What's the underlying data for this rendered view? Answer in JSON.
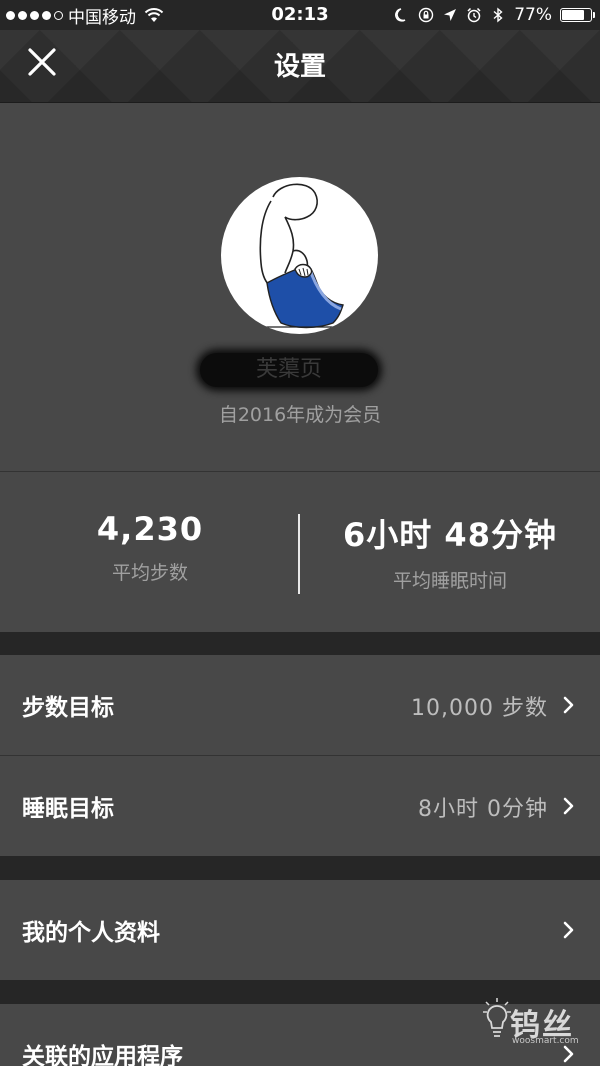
{
  "status_bar": {
    "carrier": "中国移动",
    "time": "02:13",
    "battery_percent": "77%",
    "battery_level": 0.77,
    "icons": [
      "signal-icon",
      "wifi-icon",
      "moon-icon",
      "rotation-lock-icon",
      "location-icon",
      "alarm-icon",
      "bluetooth-icon",
      "battery-icon"
    ]
  },
  "nav": {
    "title": "设置",
    "close_icon": "close-icon"
  },
  "profile": {
    "username": "芙蕖页",
    "member_since": "自2016年成为会员"
  },
  "stats": {
    "steps": {
      "value": "4,230",
      "label": "平均步数"
    },
    "sleep": {
      "value": "6小时 48分钟",
      "label": "平均睡眠时间"
    }
  },
  "settings": {
    "step_goal": {
      "label": "步数目标",
      "value": "10,000 步数"
    },
    "sleep_goal": {
      "label": "睡眠目标",
      "value": "8小时 0分钟"
    },
    "profile": {
      "label": "我的个人资料"
    },
    "linked_apps": {
      "label": "关联的应用程序"
    }
  },
  "watermark": {
    "text": "钨丝",
    "sub": "woosmart.com"
  },
  "colors": {
    "panel": "#484848",
    "background": "#262626",
    "text_secondary": "#a0a0a0",
    "text_value": "#bdbdbd"
  }
}
